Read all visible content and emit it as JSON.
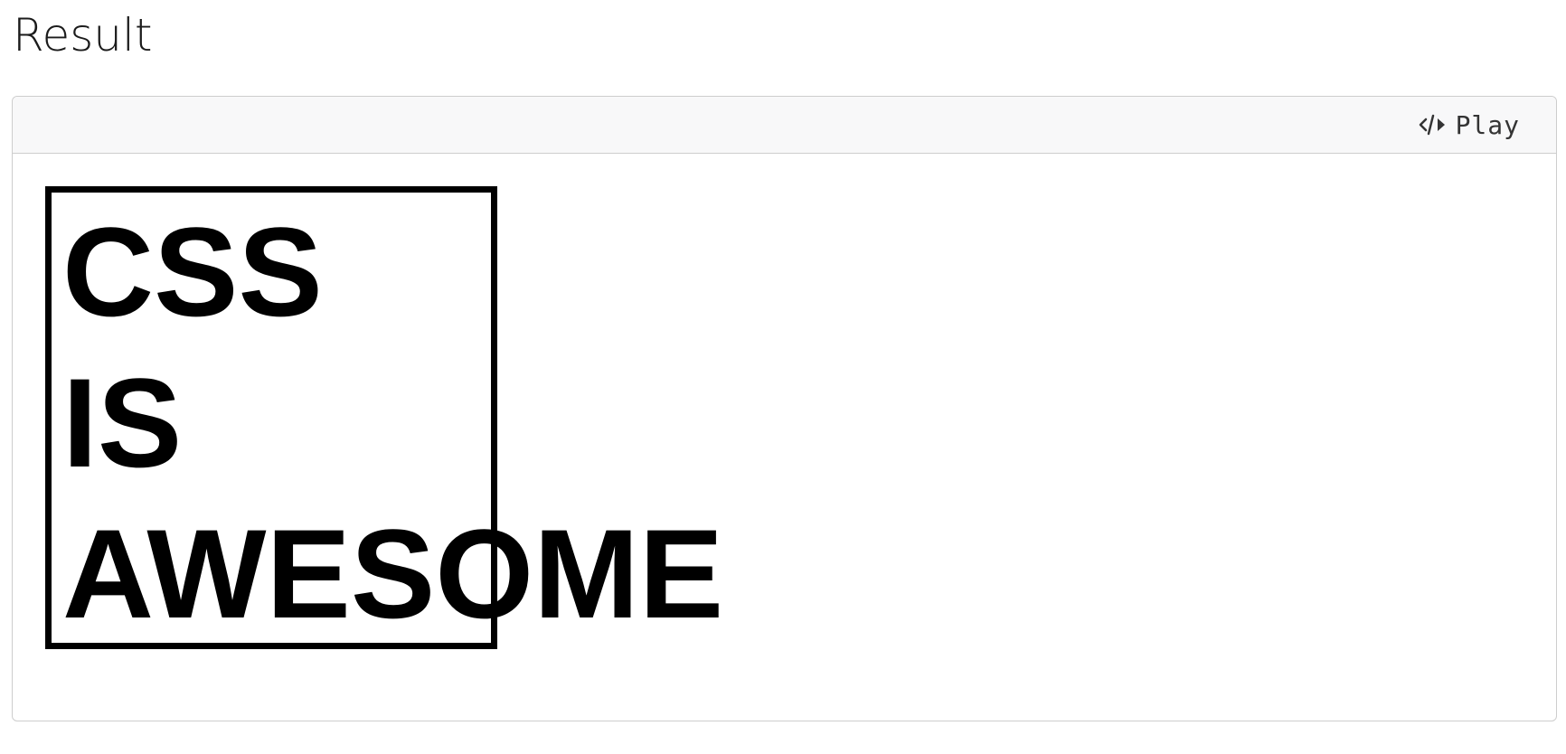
{
  "section": {
    "title": "Result"
  },
  "toolbar": {
    "play_label": "Play",
    "play_icon": "code-play-icon"
  },
  "output": {
    "lines": [
      "CSS",
      "IS",
      "AWESOME"
    ]
  }
}
